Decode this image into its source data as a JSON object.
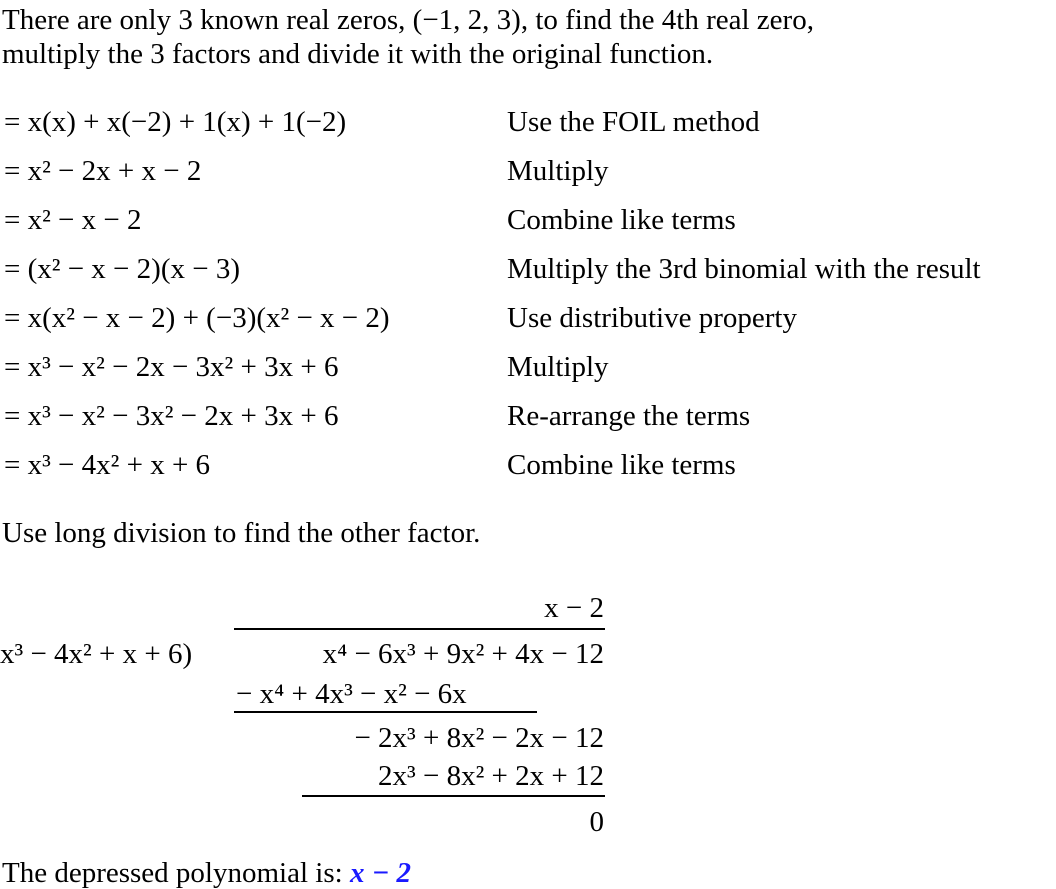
{
  "intro": {
    "line1": "There are only 3 known real zeros, (−1, 2, 3), to find the 4th real zero,",
    "line2": "multiply the 3 factors and divide it with the original function."
  },
  "steps": [
    {
      "expr": "= x(x) + x(−2) + 1(x) + 1(−2)",
      "reason": "Use the FOIL method"
    },
    {
      "expr": "= x² − 2x + x − 2",
      "reason": "Multiply"
    },
    {
      "expr": "= x² − x − 2",
      "reason": "Combine like terms"
    },
    {
      "expr": "= (x² − x − 2)(x − 3)",
      "reason": "Multiply the 3rd binomial with the result"
    },
    {
      "expr": "= x(x² − x − 2) + (−3)(x² − x − 2)",
      "reason": "Use distributive property"
    },
    {
      "expr": "= x³ − x² − 2x − 3x² + 3x + 6",
      "reason": "Multiply"
    },
    {
      "expr": "= x³ − x² − 3x² − 2x + 3x + 6",
      "reason": "Re-arrange the terms"
    },
    {
      "expr": "= x³ − 4x² + x + 6",
      "reason": "Combine like terms"
    }
  ],
  "division_intro": "Use long division to find the other factor.",
  "long_division": {
    "quotient": "x  − 2",
    "divisor": "x³ − 4x² + x + 6)",
    "dividend": "x⁴ − 6x³ + 9x² + 4x − 12",
    "sub1": "− x⁴ + 4x³   − x² − 6x",
    "rem1": "− 2x³ + 8x² − 2x − 12",
    "sub2": "2x³ − 8x² + 2x + 12",
    "remainder": "0"
  },
  "conclusion": {
    "label": "The depressed polynomial is:",
    "answer": "x − 2",
    "answer_color": "#1a1aff"
  }
}
